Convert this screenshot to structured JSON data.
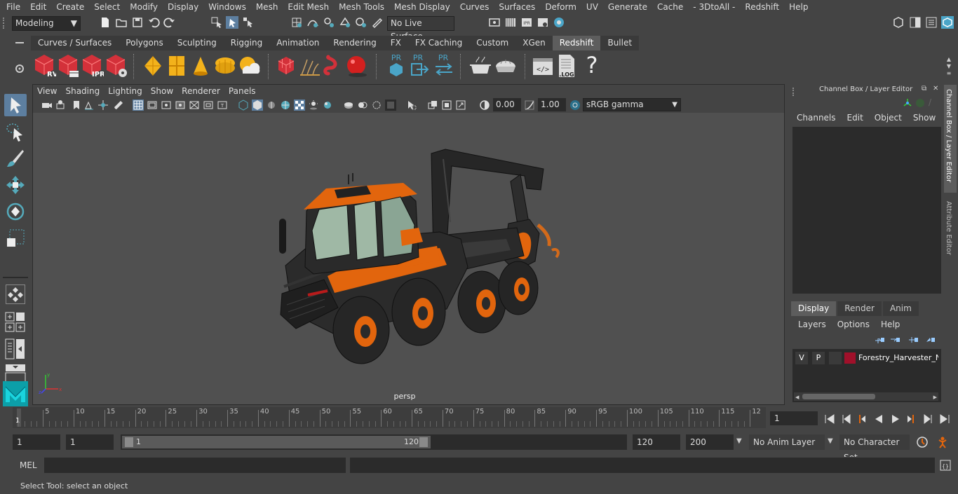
{
  "menubar": [
    "File",
    "Edit",
    "Create",
    "Select",
    "Modify",
    "Display",
    "Windows",
    "Mesh",
    "Edit Mesh",
    "Mesh Tools",
    "Mesh Display",
    "Curves",
    "Surfaces",
    "Deform",
    "UV",
    "Generate",
    "Cache",
    "- 3DtoAll -",
    "Redshift",
    "Help"
  ],
  "status": {
    "mode": "Modeling",
    "live_surface": "No Live Surface"
  },
  "shelf_tabs": [
    "Curves / Surfaces",
    "Polygons",
    "Sculpting",
    "Rigging",
    "Animation",
    "Rendering",
    "FX",
    "FX Caching",
    "Custom",
    "XGen",
    "Redshift",
    "Bullet"
  ],
  "shelf_active": "Redshift",
  "shelf_icons": {
    "rv": "RV",
    "ipr": "IPR",
    "pr": "PR",
    "log": ".LOG",
    "help": "?"
  },
  "viewport": {
    "menu": [
      "View",
      "Shading",
      "Lighting",
      "Show",
      "Renderer",
      "Panels"
    ],
    "exposure": "0.00",
    "gamma": "1.00",
    "color_space": "sRGB gamma",
    "camera": "persp"
  },
  "channel_box": {
    "title": "Channel Box / Layer Editor",
    "menu": [
      "Channels",
      "Edit",
      "Object",
      "Show"
    ]
  },
  "layer_editor": {
    "tabs": [
      "Display",
      "Render",
      "Anim"
    ],
    "active_tab": "Display",
    "menu": [
      "Layers",
      "Options",
      "Help"
    ],
    "layers": [
      {
        "v": "V",
        "p": "P",
        "color": "#a0102a",
        "name": "Forestry_Harvester_New"
      }
    ]
  },
  "side_tabs": [
    "Channel Box / Layer Editor",
    "Attribute Editor"
  ],
  "timeline": {
    "ticks": [
      "5",
      "10",
      "15",
      "20",
      "25",
      "30",
      "35",
      "40",
      "45",
      "50",
      "55",
      "60",
      "65",
      "70",
      "75",
      "80",
      "85",
      "90",
      "95",
      "100",
      "105",
      "110",
      "115",
      "12"
    ],
    "current_marker": "1",
    "current_frame": "1"
  },
  "range": {
    "start": "1",
    "inner_start": "1",
    "slider_start": "1",
    "slider_end": "120",
    "end": "120",
    "max": "200",
    "anim_layer": "No Anim Layer",
    "char_set": "No Character Set"
  },
  "cmd": {
    "lang": "MEL"
  },
  "help": {
    "text": "Select Tool: select an object"
  }
}
